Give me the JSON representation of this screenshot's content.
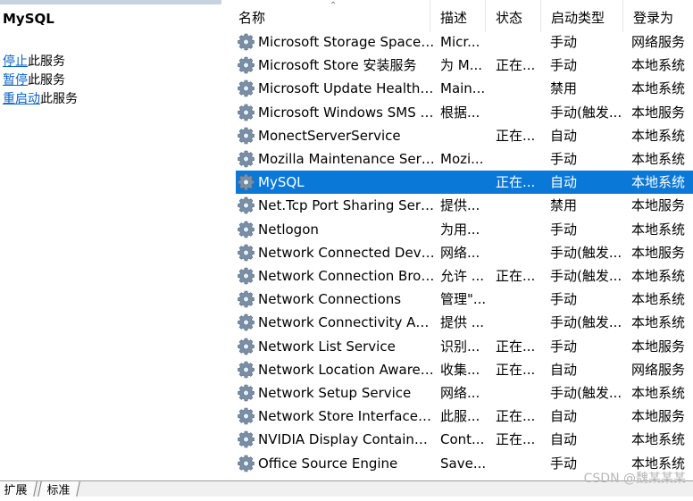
{
  "left_panel": {
    "service_name": "MySQL",
    "actions": [
      {
        "link": "停止",
        "text": "此服务"
      },
      {
        "link": "暂停",
        "text": "此服务"
      },
      {
        "link": "重启动",
        "text": "此服务"
      }
    ]
  },
  "columns": {
    "name": "名称",
    "desc": "描述",
    "status": "状态",
    "startup": "启动类型",
    "logon": "登录为"
  },
  "sort_indicator": "⌃",
  "services": [
    {
      "name": "Microsoft Storage Spaces S...",
      "desc": "Micr...",
      "status": "",
      "startup": "手动",
      "logon": "网络服务"
    },
    {
      "name": "Microsoft Store 安装服务",
      "desc": "为 M...",
      "status": "正在...",
      "startup": "手动",
      "logon": "本地系统"
    },
    {
      "name": "Microsoft Update Health S...",
      "desc": "Main...",
      "status": "",
      "startup": "禁用",
      "logon": "本地系统"
    },
    {
      "name": "Microsoft Windows SMS 路...",
      "desc": "根据...",
      "status": "",
      "startup": "手动(触发...",
      "logon": "本地服务"
    },
    {
      "name": "MonectServerService",
      "desc": "",
      "status": "正在...",
      "startup": "自动",
      "logon": "本地系统"
    },
    {
      "name": "Mozilla Maintenance Service",
      "desc": "Mozi...",
      "status": "",
      "startup": "手动",
      "logon": "本地系统"
    },
    {
      "name": "MySQL",
      "desc": "",
      "status": "正在...",
      "startup": "自动",
      "logon": "本地系统",
      "selected": true
    },
    {
      "name": "Net.Tcp Port Sharing Service",
      "desc": "提供...",
      "status": "",
      "startup": "禁用",
      "logon": "本地服务"
    },
    {
      "name": "Netlogon",
      "desc": "为用...",
      "status": "",
      "startup": "手动",
      "logon": "本地系统"
    },
    {
      "name": "Network Connected Devic...",
      "desc": "网络...",
      "status": "",
      "startup": "手动(触发...",
      "logon": "本地服务"
    },
    {
      "name": "Network Connection Broker",
      "desc": "允许 ...",
      "status": "正在...",
      "startup": "手动(触发...",
      "logon": "本地系统"
    },
    {
      "name": "Network Connections",
      "desc": "管理\"...",
      "status": "",
      "startup": "手动",
      "logon": "本地系统"
    },
    {
      "name": "Network Connectivity Assis...",
      "desc": "提供 ...",
      "status": "",
      "startup": "手动(触发...",
      "logon": "本地系统"
    },
    {
      "name": "Network List Service",
      "desc": "识别...",
      "status": "正在...",
      "startup": "手动",
      "logon": "本地服务"
    },
    {
      "name": "Network Location Awarene...",
      "desc": "收集...",
      "status": "正在...",
      "startup": "自动",
      "logon": "网络服务"
    },
    {
      "name": "Network Setup Service",
      "desc": "网络...",
      "status": "",
      "startup": "手动(触发...",
      "logon": "本地系统"
    },
    {
      "name": "Network Store Interface Se...",
      "desc": "此服...",
      "status": "正在...",
      "startup": "自动",
      "logon": "本地服务"
    },
    {
      "name": "NVIDIA Display Container LS",
      "desc": "Cont...",
      "status": "正在...",
      "startup": "自动",
      "logon": "本地系统"
    },
    {
      "name": "Office  Source Engine",
      "desc": "Save...",
      "status": "",
      "startup": "手动",
      "logon": "本地系统"
    }
  ],
  "bottom_tabs": [
    "扩展",
    "标准"
  ],
  "watermark": "CSDN @魏某某某",
  "colors": {
    "selection": "#0a78d7",
    "link": "#0a63c7"
  }
}
